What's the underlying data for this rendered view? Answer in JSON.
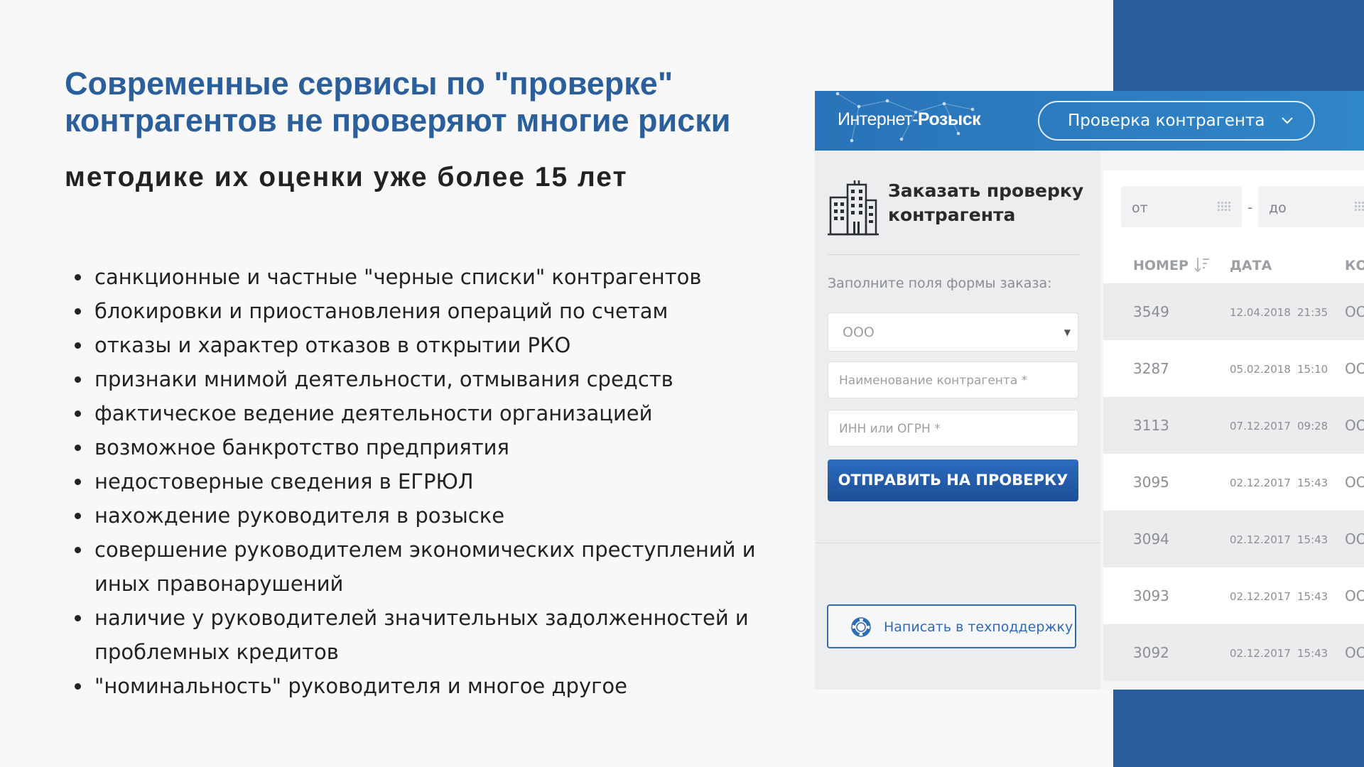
{
  "slide": {
    "title_line1": "Современные сервисы по \"проверке\"",
    "title_line2": "контрагентов не проверяют многие риски",
    "subtitle": "методике их оценки уже более 15 лет",
    "bullets": [
      "санкционные и частные \"черные списки\" контрагентов",
      "блокировки и приостановления операций по счетам",
      "отказы и характер отказов в открытии РКО",
      "признаки мнимой деятельности, отмывания средств",
      "фактическое ведение деятельности организацией",
      "возможное банкротство предприятия",
      "недостоверные сведения в ЕГРЮЛ",
      "нахождение руководителя в розыске",
      "совершение руководителем экономических преступлений и иных правонарушений",
      "наличие у руководителей значительных задолженностей и проблемных кредитов",
      "\"номинальность\" руководителя и многое другое"
    ]
  },
  "app": {
    "logo_part1": "Интернет-",
    "logo_part2": "Розыск",
    "service_select": "Проверка контрагента",
    "order_title": "Заказать проверку контрагента",
    "form_hint": "Заполните поля формы заказа:",
    "org_type_value": "ООО",
    "name_placeholder": "Наименование контрагента *",
    "inn_placeholder": "ИНН или ОГРН *",
    "submit_label": "ОТПРАВИТЬ НА ПРОВЕРКУ",
    "support_label": "Написать в техподдержку",
    "date_from_placeholder": "от",
    "date_to_placeholder": "до",
    "date_separator": "-",
    "columns": {
      "number": "НОМЕР",
      "date": "ДАТА",
      "contractor": "КОН"
    },
    "rows": [
      {
        "number": "3549",
        "date": "12.04.2018",
        "time": "21:35",
        "org": "ОО"
      },
      {
        "number": "3287",
        "date": "05.02.2018",
        "time": "15:10",
        "org": "ОО"
      },
      {
        "number": "3113",
        "date": "07.12.2017",
        "time": "09:28",
        "org": "ОО"
      },
      {
        "number": "3095",
        "date": "02.12.2017",
        "time": "15:43",
        "org": "ОО"
      },
      {
        "number": "3094",
        "date": "02.12.2017",
        "time": "15:43",
        "org": "ОО"
      },
      {
        "number": "3093",
        "date": "02.12.2017",
        "time": "15:43",
        "org": "ОО"
      },
      {
        "number": "3092",
        "date": "02.12.2017",
        "time": "15:43",
        "org": "ОО"
      }
    ]
  },
  "colors": {
    "accent_blue": "#2a5d9e",
    "title_blue": "#2b5f9b",
    "header_blue": "#2f86c8",
    "button_blue": "#1d4e95"
  }
}
